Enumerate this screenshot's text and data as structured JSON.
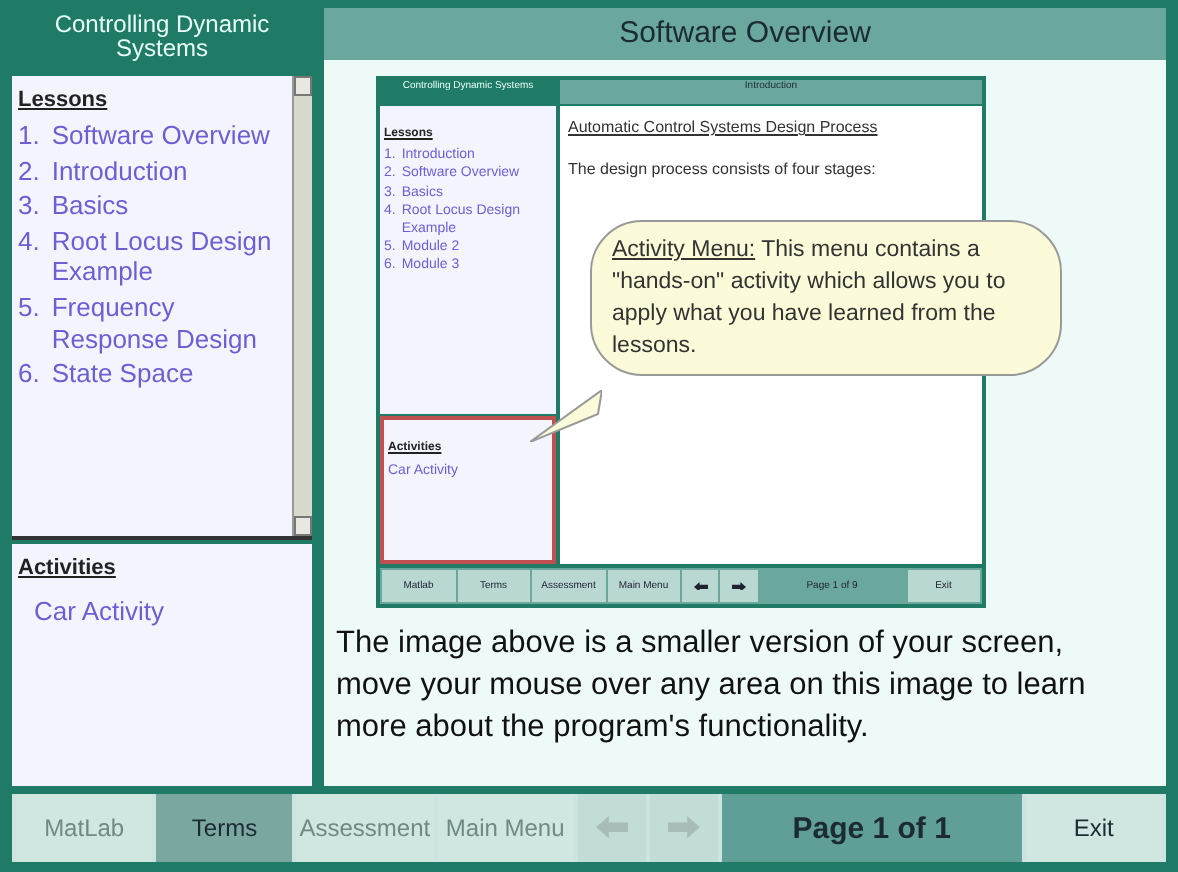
{
  "sidebar": {
    "title": "Controlling Dynamic Systems",
    "lessons": {
      "heading": "Lessons",
      "items": [
        {
          "number": "1.",
          "label": "Software Overview"
        },
        {
          "number": "2.",
          "label": "Introduction"
        },
        {
          "number": "3.",
          "label": "Basics"
        },
        {
          "number": "4.",
          "label": "Root Locus Design Example"
        },
        {
          "number": "5.",
          "label": "Frequency Response Design"
        },
        {
          "number": "6.",
          "label": "State Space"
        }
      ]
    },
    "activities": {
      "heading": "Activities",
      "items": [
        "Car Activity"
      ]
    }
  },
  "main": {
    "title": "Software Overview",
    "preview": {
      "sidebar_title": "Controlling Dynamic Systems",
      "title": "Introduction",
      "lessons_heading": "Lessons",
      "lessons": [
        {
          "number": "1.",
          "label": "Introduction"
        },
        {
          "number": "2.",
          "label": "Software Overview"
        },
        {
          "number": "3.",
          "label": "Basics"
        },
        {
          "number": "4.",
          "label": "Root Locus Design Example"
        },
        {
          "number": "5.",
          "label": "Module 2"
        },
        {
          "number": "6.",
          "label": "Module 3"
        }
      ],
      "activities_heading": "Activities",
      "activities": [
        "Car Activity"
      ],
      "heading": "Automatic Control Systems Design Process",
      "text": "The design process consists of four stages:",
      "nav": [
        {
          "kind": "text",
          "label": "Matlab"
        },
        {
          "kind": "text",
          "label": "Terms"
        },
        {
          "kind": "text",
          "label": "Assessment"
        },
        {
          "kind": "text",
          "label": "Main Menu"
        },
        {
          "kind": "back"
        },
        {
          "kind": "forward"
        },
        {
          "kind": "page",
          "label": "Page 1 of 9"
        },
        {
          "kind": "text",
          "label": "Exit"
        }
      ]
    },
    "callout": {
      "heading": "Activity Menu:",
      "text": "This menu contains a \"hands-on\" activity which allows you to apply what you have learned from the lessons."
    },
    "description": "The image above is a smaller version of your screen, move your mouse over any area on this image to learn more about the program's functionality."
  },
  "nav": [
    {
      "kind": "text",
      "label": "MatLab",
      "disabled": true,
      "selected": false
    },
    {
      "kind": "text",
      "label": "Terms",
      "disabled": false,
      "selected": true
    },
    {
      "kind": "text",
      "label": "Assessment",
      "disabled": true,
      "selected": false
    },
    {
      "kind": "text",
      "label": "Main Menu",
      "disabled": true,
      "selected": false
    },
    {
      "kind": "back",
      "disabled": true,
      "selected": false
    },
    {
      "kind": "forward",
      "disabled": true,
      "selected": false
    },
    {
      "kind": "page",
      "label": "Page 1 of 1",
      "disabled": false,
      "selected": false
    },
    {
      "kind": "text",
      "label": "Exit",
      "disabled": false,
      "selected": false
    }
  ]
}
